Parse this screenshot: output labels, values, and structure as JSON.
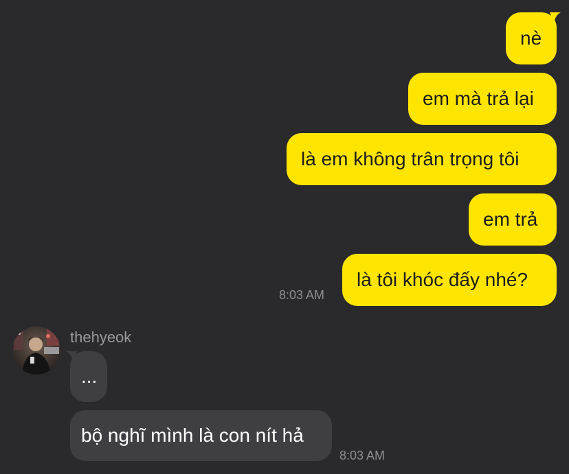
{
  "conversation": {
    "outgoing": [
      {
        "text": "nè"
      },
      {
        "text": "em mà trả lại"
      },
      {
        "text": "là em không trân trọng tôi"
      },
      {
        "text": "em trả"
      },
      {
        "text": "là tôi khóc đấy nhé?"
      }
    ],
    "outgoing_time": "8:03 AM",
    "incoming_sender": "thehyeok",
    "incoming": [
      {
        "text": "..."
      },
      {
        "text": "bộ nghĩ mình là con nít hả"
      }
    ],
    "incoming_time": "8:03 AM"
  },
  "colors": {
    "background": "#2a2a2d",
    "outgoing_bubble": "#fee500",
    "incoming_bubble": "#3f3f43",
    "timestamp": "#8e8e93"
  }
}
